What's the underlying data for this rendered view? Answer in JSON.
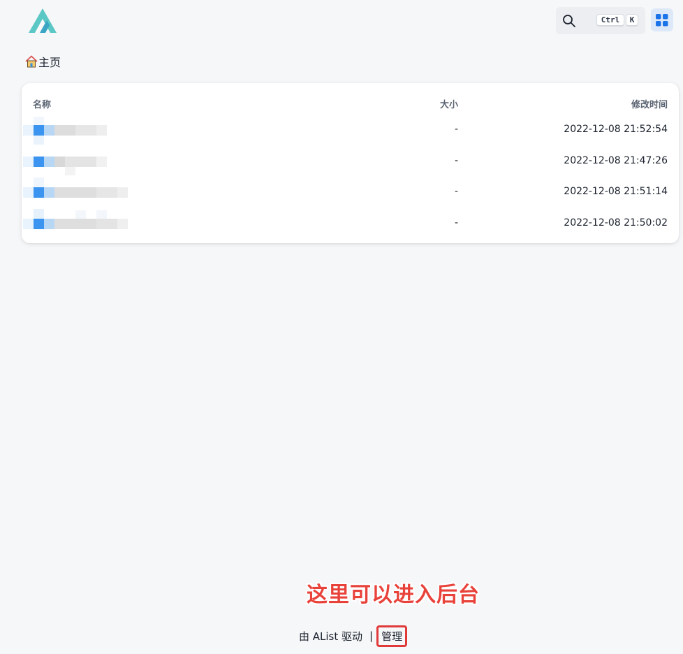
{
  "header": {
    "logo_icon": "alist-logo-icon",
    "search": {
      "icon": "search-icon",
      "shortcut_keys": [
        "Ctrl",
        "K"
      ]
    },
    "layout_toggle_icon": "grid-layout-icon"
  },
  "breadcrumb": {
    "home_icon": "home-icon",
    "home_label": "主页"
  },
  "table": {
    "headers": {
      "name": "名称",
      "size": "大小",
      "modified": "修改时间"
    },
    "rows": [
      {
        "name": "",
        "size": "-",
        "modified": "2022-12-08 21:52:54"
      },
      {
        "name": "",
        "size": "-",
        "modified": "2022-12-08 21:47:26"
      },
      {
        "name": "",
        "size": "-",
        "modified": "2022-12-08 21:51:14"
      },
      {
        "name": "",
        "size": "-",
        "modified": "2022-12-08 21:50:02"
      }
    ]
  },
  "annotation": "这里可以进入后台",
  "footer": {
    "powered_by": "由 AList 驱动",
    "separator": "|",
    "manage_label": "管理"
  },
  "colors": {
    "accent": "#1a73e8",
    "logo_teal": "#5cc8c6",
    "annotation_red": "#e8423b",
    "background": "#f6f7f9"
  }
}
